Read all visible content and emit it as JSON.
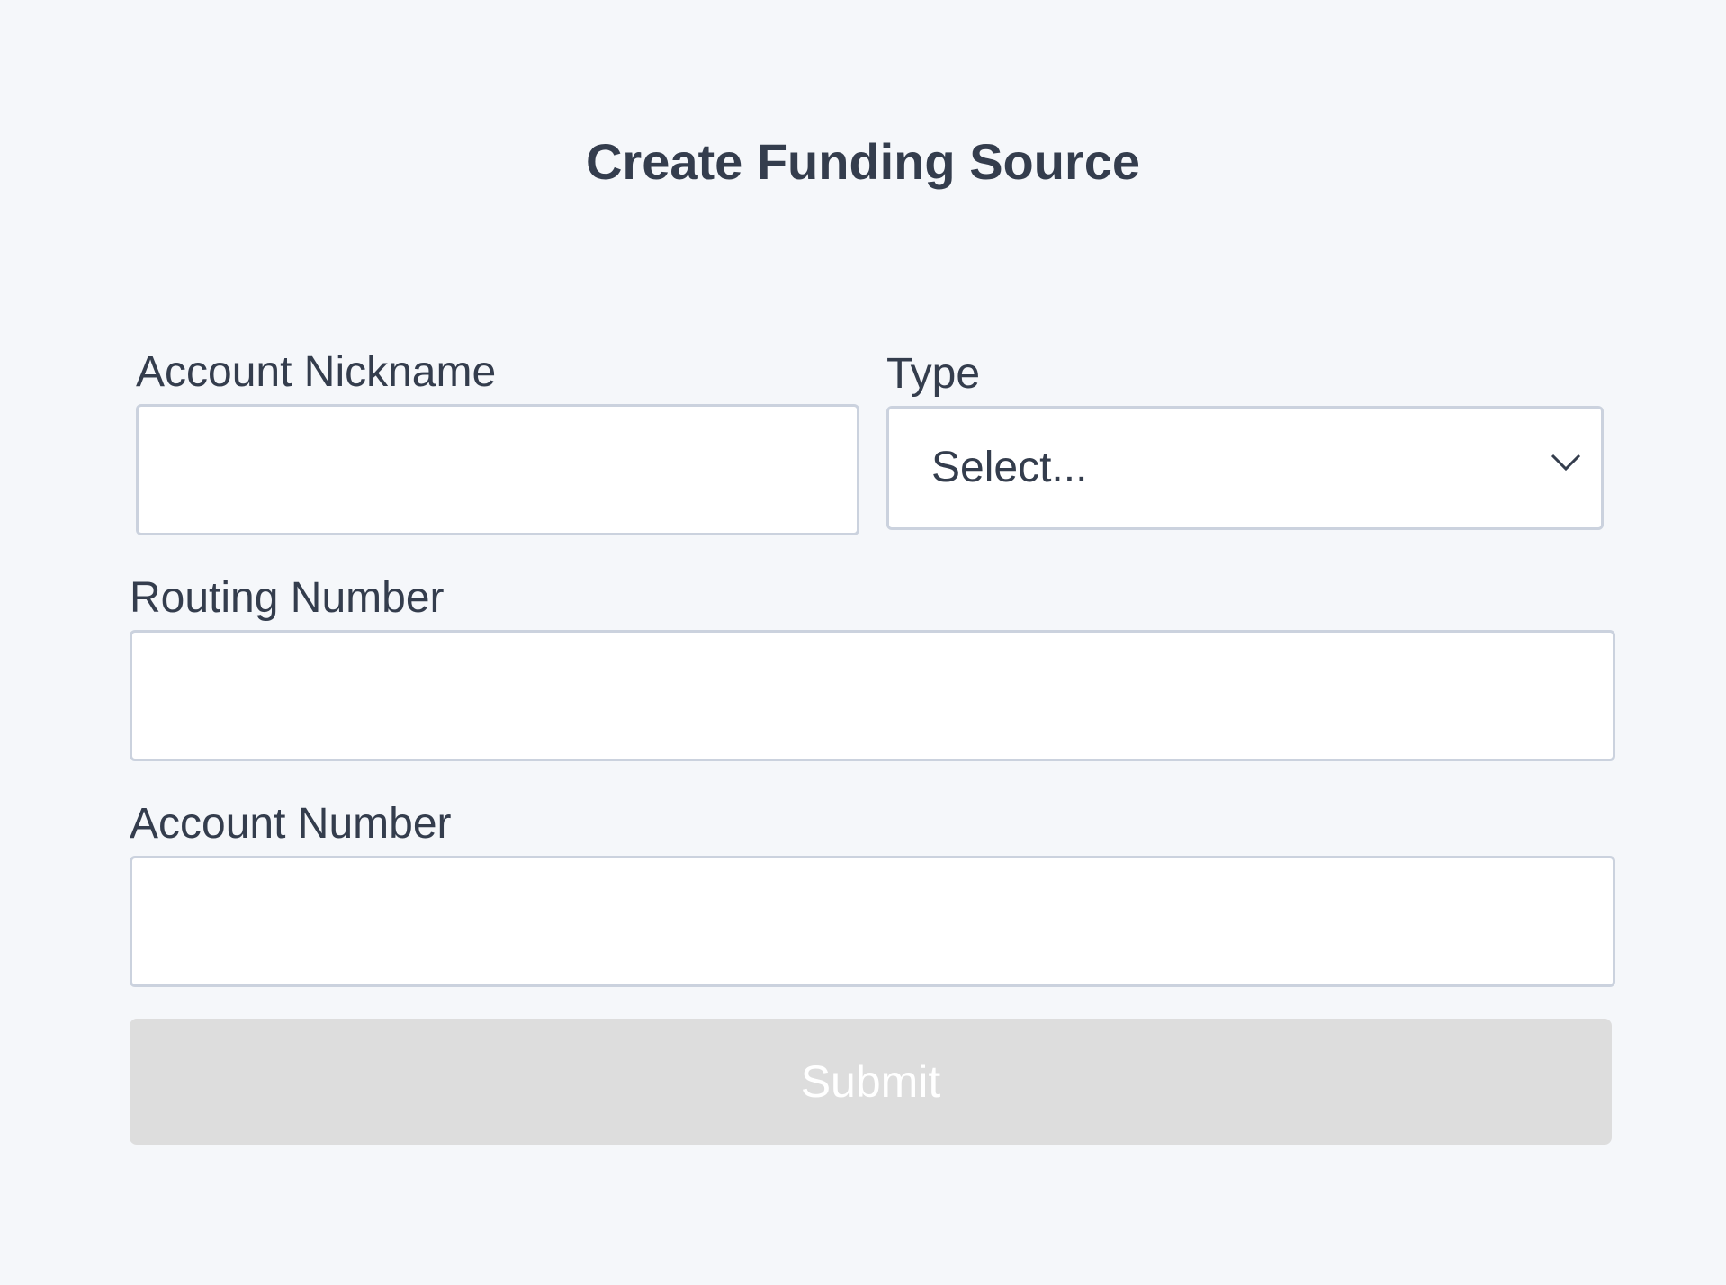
{
  "form": {
    "title": "Create Funding Source",
    "nickname": {
      "label": "Account Nickname",
      "value": "",
      "placeholder": ""
    },
    "type": {
      "label": "Type",
      "selected": "Select..."
    },
    "routing": {
      "label": "Routing Number",
      "value": "",
      "placeholder": ""
    },
    "account": {
      "label": "Account Number",
      "value": "",
      "placeholder": ""
    },
    "submit_label": "Submit"
  },
  "icons": {
    "select_chevron": "chevron-down-icon"
  },
  "colors": {
    "background": "#f5f7fa",
    "text": "#343d4d",
    "field_border": "#cbd2de",
    "field_background": "#ffffff",
    "submit_background_disabled": "#dddddd",
    "submit_text": "#ffffff"
  }
}
